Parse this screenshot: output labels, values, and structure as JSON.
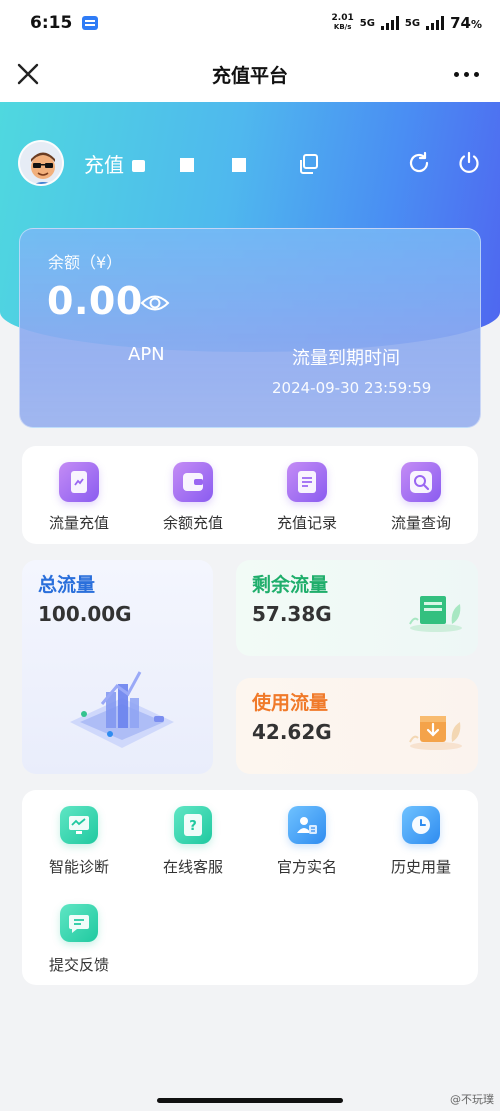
{
  "status_bar": {
    "time": "6:15",
    "net_speed": "2.01",
    "net_speed_unit": "KB/s",
    "net_type_1": "5G",
    "net_type_2": "5G",
    "battery": "74",
    "battery_unit": "%"
  },
  "title_bar": {
    "title": "充值平台",
    "close_icon": "close-icon",
    "more_icon": "more-icon"
  },
  "user": {
    "name_prefix": "充值"
  },
  "balance": {
    "label": "余额（¥）",
    "value": "0.00",
    "apn_label": "APN",
    "expire_label": "流量到期时间",
    "expire_time": "2024-09-30 23:59:59"
  },
  "quick_actions": [
    {
      "label": "流量充值",
      "icon": "phone-traffic-icon"
    },
    {
      "label": "余额充值",
      "icon": "wallet-icon"
    },
    {
      "label": "充值记录",
      "icon": "record-list-icon"
    },
    {
      "label": "流量查询",
      "icon": "search-icon"
    }
  ],
  "traffic": {
    "total": {
      "title": "总流量",
      "value": "100.00G"
    },
    "remaining": {
      "title": "剩余流量",
      "value": "57.38G"
    },
    "used": {
      "title": "使用流量",
      "value": "42.62G"
    }
  },
  "services": [
    {
      "label": "智能诊断",
      "icon": "diagnosis-icon"
    },
    {
      "label": "在线客服",
      "icon": "customer-service-icon"
    },
    {
      "label": "官方实名",
      "icon": "id-card-icon"
    },
    {
      "label": "历史用量",
      "icon": "history-clock-icon"
    },
    {
      "label": "提交反馈",
      "icon": "feedback-icon"
    }
  ],
  "watermark": "@不玩璞",
  "colors": {
    "accent_blue": "#2a6fdb",
    "accent_green": "#1fae6b",
    "accent_orange": "#f07a2a",
    "purple_icon": "#8a5cf0"
  }
}
